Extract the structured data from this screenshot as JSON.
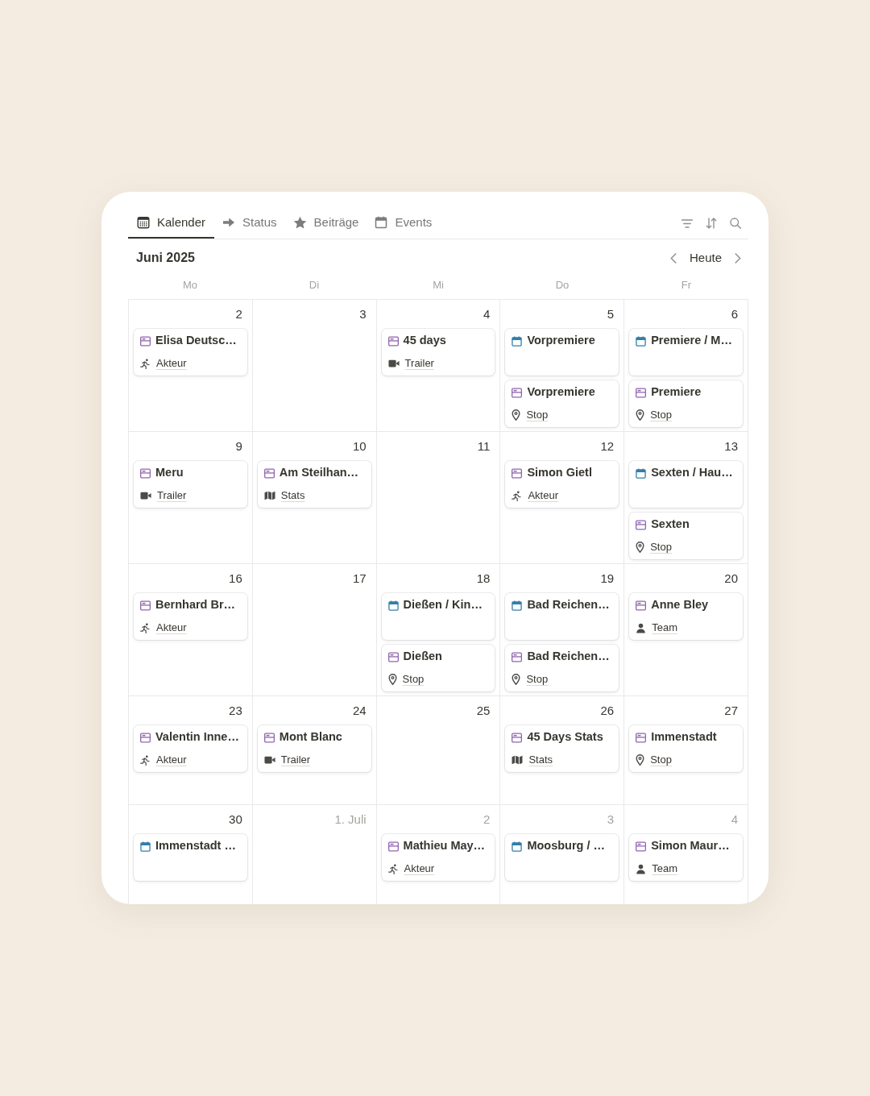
{
  "tabs": [
    {
      "label": "Kalender",
      "kind": "grid",
      "selected": true
    },
    {
      "label": "Status",
      "kind": "arrow",
      "selected": false
    },
    {
      "label": "Beiträge",
      "kind": "star",
      "selected": false
    },
    {
      "label": "Events",
      "kind": "calendar",
      "selected": false
    }
  ],
  "header": {
    "month": "Juni 2025",
    "today": "Heute"
  },
  "weekdays": [
    "Mo",
    "Di",
    "Mi",
    "Do",
    "Fr"
  ],
  "weeks": [
    {
      "days": [
        {
          "date": "2",
          "other_month": false,
          "events": [
            {
              "kind": "post",
              "title": "Elisa Deutsc…",
              "property": {
                "kind": "runner",
                "label": "Akteur"
              }
            }
          ]
        },
        {
          "date": "3",
          "other_month": false
        },
        {
          "date": "4",
          "other_month": false,
          "events": [
            {
              "kind": "post",
              "title": "45 days",
              "property": {
                "kind": "camera",
                "label": "Trailer"
              }
            }
          ]
        },
        {
          "date": "5",
          "other_month": false,
          "events": [
            {
              "kind": "event",
              "title": "Vorpremiere"
            },
            {
              "kind": "post",
              "title": "Vorpremiere",
              "property": {
                "kind": "pin",
                "label": "Stop"
              }
            }
          ]
        },
        {
          "date": "6",
          "other_month": false,
          "events": [
            {
              "kind": "event",
              "title": "Premiere / M…"
            },
            {
              "kind": "post",
              "title": "Premiere",
              "property": {
                "kind": "pin",
                "label": "Stop"
              }
            }
          ]
        }
      ]
    },
    {
      "days": [
        {
          "date": "9",
          "other_month": false,
          "events": [
            {
              "kind": "post",
              "title": "Meru",
              "property": {
                "kind": "camera",
                "label": "Trailer"
              }
            }
          ]
        },
        {
          "date": "10",
          "other_month": false,
          "events": [
            {
              "kind": "post",
              "title": "Am Steilhan…",
              "property": {
                "kind": "map",
                "label": "Stats"
              }
            }
          ]
        },
        {
          "date": "11",
          "other_month": false
        },
        {
          "date": "12",
          "other_month": false,
          "events": [
            {
              "kind": "post",
              "title": "Simon Gietl",
              "property": {
                "kind": "runner",
                "label": "Akteur"
              }
            }
          ]
        },
        {
          "date": "13",
          "other_month": false,
          "events": [
            {
              "kind": "event",
              "title": "Sexten / Hau…"
            },
            {
              "kind": "post",
              "title": "Sexten",
              "property": {
                "kind": "pin",
                "label": "Stop"
              }
            }
          ]
        }
      ]
    },
    {
      "days": [
        {
          "date": "16",
          "other_month": false,
          "events": [
            {
              "kind": "post",
              "title": "Bernhard Br…",
              "property": {
                "kind": "runner",
                "label": "Akteur"
              }
            }
          ]
        },
        {
          "date": "17",
          "other_month": false
        },
        {
          "date": "18",
          "other_month": false,
          "events": [
            {
              "kind": "event",
              "title": "Dießen / Kin…"
            },
            {
              "kind": "post",
              "title": "Dießen",
              "property": {
                "kind": "pin",
                "label": "Stop"
              }
            }
          ]
        },
        {
          "date": "19",
          "other_month": false,
          "events": [
            {
              "kind": "event",
              "title": "Bad Reichen…"
            },
            {
              "kind": "post",
              "title": "Bad Reichen…",
              "property": {
                "kind": "pin",
                "label": "Stop"
              }
            }
          ]
        },
        {
          "date": "20",
          "other_month": false,
          "events": [
            {
              "kind": "post",
              "title": "Anne Bley",
              "property": {
                "kind": "person",
                "label": "Team"
              }
            }
          ]
        }
      ]
    },
    {
      "days": [
        {
          "date": "23",
          "other_month": false,
          "events": [
            {
              "kind": "post",
              "title": "Valentin Inne…",
              "property": {
                "kind": "runner",
                "label": "Akteur"
              }
            }
          ]
        },
        {
          "date": "24",
          "other_month": false,
          "events": [
            {
              "kind": "post",
              "title": "Mont Blanc",
              "property": {
                "kind": "camera",
                "label": "Trailer"
              }
            }
          ]
        },
        {
          "date": "25",
          "other_month": false
        },
        {
          "date": "26",
          "other_month": false,
          "events": [
            {
              "kind": "post",
              "title": "45 Days Stats",
              "property": {
                "kind": "map",
                "label": "Stats"
              }
            }
          ]
        },
        {
          "date": "27",
          "other_month": false,
          "events": [
            {
              "kind": "post",
              "title": "Immenstadt",
              "property": {
                "kind": "pin",
                "label": "Stop"
              }
            }
          ]
        }
      ]
    },
    {
      "days": [
        {
          "date": "30",
          "other_month": false,
          "events": [
            {
              "kind": "event",
              "title": "Immenstadt …"
            }
          ]
        },
        {
          "date": "1. Juli",
          "other_month": true
        },
        {
          "date": "2",
          "other_month": true,
          "events": [
            {
              "kind": "post",
              "title": "Mathieu May…",
              "property": {
                "kind": "runner",
                "label": "Akteur"
              }
            }
          ]
        },
        {
          "date": "3",
          "other_month": true,
          "events": [
            {
              "kind": "event",
              "title": "Moosburg / …"
            }
          ]
        },
        {
          "date": "4",
          "other_month": true,
          "events": [
            {
              "kind": "post",
              "title": "Simon Maur…",
              "property": {
                "kind": "person",
                "label": "Team"
              }
            }
          ]
        }
      ]
    }
  ]
}
